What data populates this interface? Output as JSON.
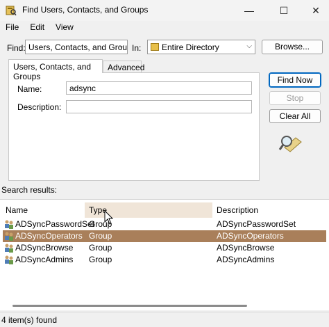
{
  "window": {
    "title": "Find Users, Contacts, and Groups"
  },
  "menu": [
    "File",
    "Edit",
    "View"
  ],
  "find": {
    "label": "Find:",
    "value": "Users, Contacts, and Groups"
  },
  "in": {
    "label": "In:",
    "value": "Entire Directory"
  },
  "browse_label": "Browse...",
  "tabs": [
    "Users, Contacts, and Groups",
    "Advanced"
  ],
  "form": {
    "name_label": "Name:",
    "name_value": "adsync",
    "description_label": "Description:",
    "description_value": ""
  },
  "buttons": {
    "find_now": "Find Now",
    "stop": "Stop",
    "clear_all": "Clear All"
  },
  "results": {
    "label": "Search results:",
    "columns": [
      "Name",
      "Type",
      "Description"
    ],
    "rows": [
      {
        "name": "ADSyncPasswordSet",
        "type": "Group",
        "description": "ADSyncPasswordSet"
      },
      {
        "name": "ADSyncOperators",
        "type": "Group",
        "description": "ADSyncOperators"
      },
      {
        "name": "ADSyncBrowse",
        "type": "Group",
        "description": "ADSyncBrowse"
      },
      {
        "name": "ADSyncAdmins",
        "type": "Group",
        "description": "ADSyncAdmins"
      }
    ],
    "selected_row": 1
  },
  "status": "4 item(s) found",
  "colors": {
    "selection": "#a97f5a",
    "sorted_header": "#f0e5d8",
    "accent": "#0067c0"
  }
}
